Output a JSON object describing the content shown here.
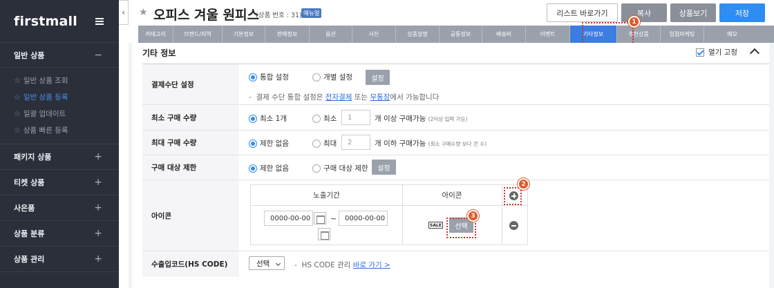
{
  "sidebar": {
    "logo": "firstmall",
    "sections": [
      {
        "label": "일반 상품",
        "toggle": "−"
      },
      {
        "label": "패키지 상품",
        "toggle": "+"
      },
      {
        "label": "티켓 상품",
        "toggle": "+"
      },
      {
        "label": "사은품",
        "toggle": "+"
      },
      {
        "label": "상품 분류",
        "toggle": "+"
      },
      {
        "label": "상품 관리",
        "toggle": "+"
      }
    ],
    "sub_items": [
      {
        "label": "일반 상품 조회"
      },
      {
        "label": "일반 상품 등록"
      },
      {
        "label": "일괄 업데이트"
      },
      {
        "label": "상품 빠른 등록"
      }
    ]
  },
  "header": {
    "title": "오피스 겨울 원피스",
    "product_no": "(상품 번호 : 31)",
    "badge": "매뉴얼",
    "buttons": {
      "list": "리스트 바로가기",
      "copy": "복사",
      "view": "상품보기",
      "save": "저장"
    }
  },
  "tabs": [
    {
      "label": "카테고리"
    },
    {
      "label": "브랜드/지역"
    },
    {
      "label": "기본정보"
    },
    {
      "label": "판매정보"
    },
    {
      "label": "옵션"
    },
    {
      "label": "사진"
    },
    {
      "label": "상품설명"
    },
    {
      "label": "공통정보"
    },
    {
      "label": "배송비"
    },
    {
      "label": "이벤트"
    },
    {
      "label": "기타정보"
    },
    {
      "label": "추천상품"
    },
    {
      "label": "입점마케팅"
    },
    {
      "label": "메모"
    }
  ],
  "section": {
    "title": "기타 정보",
    "fix_label": "열기 고정"
  },
  "payment": {
    "label": "결제수단 설정",
    "opt1": "통합 설정",
    "opt2": "개별 설정",
    "btn": "설정",
    "note_dash": "-",
    "note_a": "결제 수단 통합 설정은",
    "link1": "전자결제",
    "note_b": "또는",
    "link2": "무통장",
    "note_c": "에서 가능합니다"
  },
  "min_qty": {
    "label": "최소 구매 수량",
    "opt1": "최소 1개",
    "opt2": "최소",
    "value": "1",
    "suffix": "개 이상 구매가능",
    "hint": "(2이상 입력 가능)"
  },
  "max_qty": {
    "label": "최대 구매 수량",
    "opt1": "제한 없음",
    "opt2": "최대",
    "value": "2",
    "suffix": "개 이하 구매가능",
    "hint": "(최소 구매수량 보다 큰 수)"
  },
  "target": {
    "label": "구매 대상 제한",
    "opt1": "제한 없음",
    "opt2": "구매 대상 제한",
    "btn": "설정"
  },
  "icon": {
    "label": "아이콘",
    "col_period": "노출기간",
    "col_icon": "아이콘",
    "start": "0000-00-00",
    "tilde": "~",
    "end": "0000-00-00",
    "icon_text": "SALE",
    "select_btn": "선택"
  },
  "hs": {
    "label": "수출입코드(HS CODE)",
    "select": "선택",
    "note_dash": "-",
    "note": "HS CODE 관리",
    "link": "바로 가기 >"
  },
  "callouts": {
    "n1": "1",
    "n2": "2",
    "n3": "3"
  },
  "colors": {
    "accent": "#2f8cf0",
    "sidebar_bg": "#2b2f3a",
    "callout": "#d62b2b",
    "badge": "#e0582b"
  }
}
